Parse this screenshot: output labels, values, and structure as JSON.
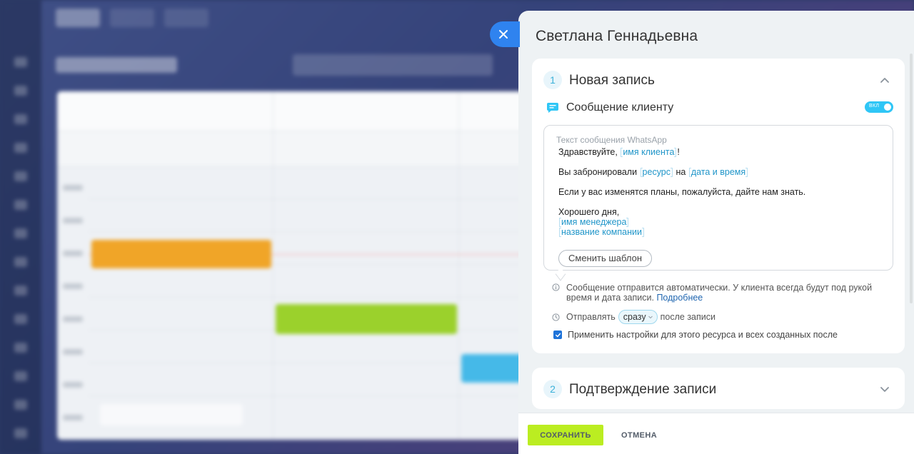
{
  "panel": {
    "title": "Светлана Геннадьевна"
  },
  "sections": [
    {
      "number": "1",
      "title": "Новая запись",
      "expanded": true,
      "message": {
        "header": "Сообщение клиенту",
        "toggle_label": "ВКЛ",
        "placeholder": "Текст сообщения WhatsApp",
        "greeting_before": "Здравствуйте, ",
        "tag_client_name": "имя клиента",
        "greeting_after": "!",
        "booked_before": "Вы забронировали ",
        "tag_resource": "ресурс",
        "booked_middle": " на ",
        "tag_datetime": "дата и время",
        "plans_line": "Если у вас изменятся планы, пожалуйста, дайте нам знать.",
        "farewell": "Хорошего дня,",
        "tag_manager_name": "имя менеджера",
        "tag_company_name": "название компании",
        "change_template_label": "Сменить шаблон"
      },
      "info_text": "Сообщение отправится автоматически. У клиента всегда будут под рукой время и дата записи. ",
      "info_link": "Подробнее",
      "send_before": "Отправлять",
      "send_option": "сразу",
      "send_after": "после записи",
      "apply_label": "Применить настройки для этого ресурса и всех созданных после"
    },
    {
      "number": "2",
      "title": "Подтверждение записи",
      "expanded": false
    }
  ],
  "footer": {
    "save_label": "СОХРАНИТЬ",
    "cancel_label": "ОТМЕНА"
  },
  "colors": {
    "accent": "#2fc6f6",
    "save_button": "#bbed21",
    "close_button": "#2f83ef",
    "tag": "#2196c9"
  }
}
